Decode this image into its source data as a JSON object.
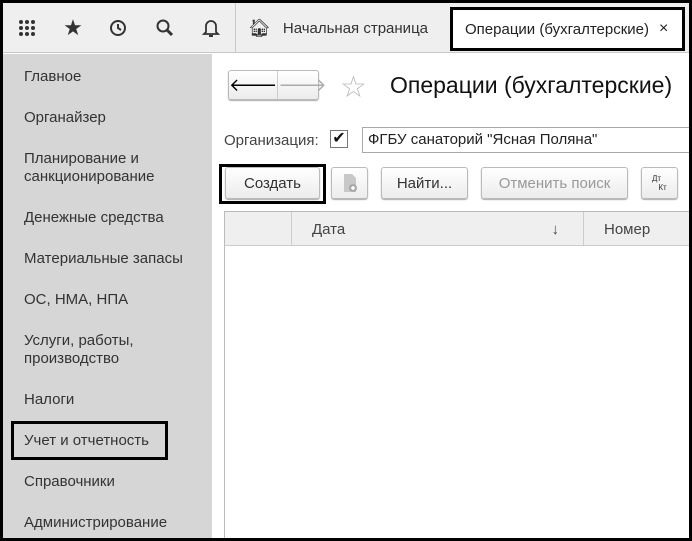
{
  "topbar": {
    "icons": [
      "apps-grid-icon",
      "star-icon",
      "history-icon",
      "search-icon",
      "bell-icon"
    ],
    "home_tab": "Начальная страница",
    "active_tab": "Операции (бухгалтерские)",
    "close": "×"
  },
  "sidebar": {
    "items": [
      "Главное",
      "Органайзер",
      "Планирование и санкционирование",
      "Денежные средства",
      "Материальные запасы",
      "ОС, НМА, НПА",
      "Услуги, работы, производство",
      "Налоги",
      "Учет и отчетность",
      "Справочники",
      "Администрирование"
    ]
  },
  "main": {
    "title": "Операции (бухгалтерские)",
    "org_label": "Организация:",
    "org_checked": true,
    "org_value": "ФГБУ санаторий \"Ясная Поляна\"",
    "buttons": {
      "create": "Создать",
      "find": "Найти...",
      "cancel_search": "Отменить поиск",
      "dt": "Дт",
      "kt": "Кт"
    },
    "table": {
      "columns": [
        "Дата",
        "Номер"
      ],
      "sort_icon": "↓",
      "rows": []
    }
  }
}
